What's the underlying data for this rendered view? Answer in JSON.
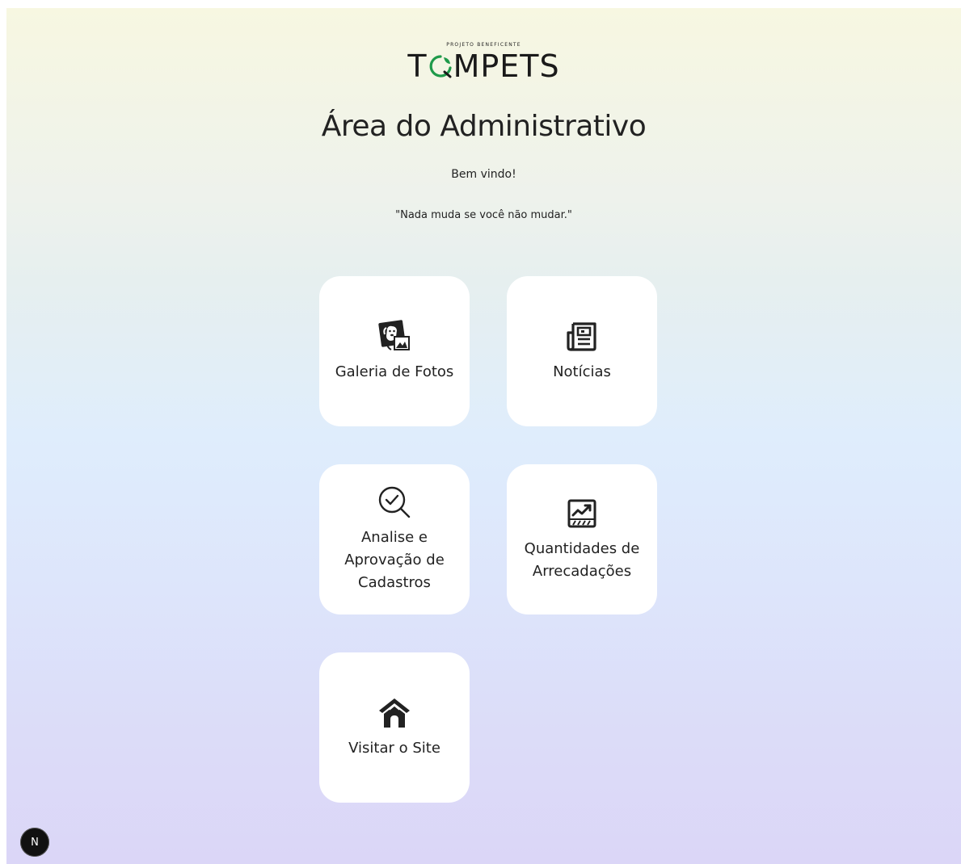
{
  "logo": {
    "tagline": "PROJETO BENEFICENTE",
    "word_start": "T",
    "word_end": "MPETS",
    "accent_color": "#1f9a4a"
  },
  "header": {
    "title": "Área do Administrativo",
    "welcome": "Bem vindo!",
    "quote": "\"Nada muda se você não mudar.\""
  },
  "cards": [
    {
      "label": "Galeria de Fotos",
      "icon": "dog-photo-icon"
    },
    {
      "label": "Notícias",
      "icon": "newspaper-icon"
    },
    {
      "label": "Analise e Aprovação de Cadastros",
      "icon": "search-check-icon"
    },
    {
      "label": "Quantidades de Arrecadações",
      "icon": "chart-icon"
    },
    {
      "label": "Visitar o Site",
      "icon": "dog-house-icon"
    }
  ],
  "dev_badge": {
    "label": "N"
  }
}
